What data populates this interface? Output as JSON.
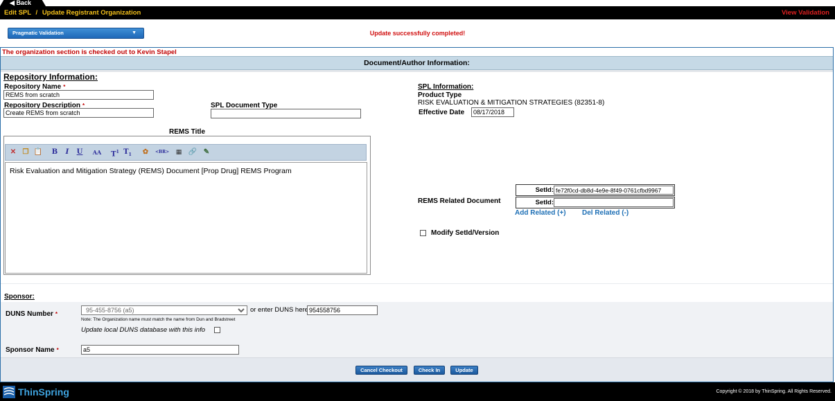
{
  "nav": {
    "back_label": "Back",
    "crumb_edit": "Edit SPL",
    "crumb_sep": "/",
    "crumb_current": "Update Registrant Organization",
    "view_validation": "View Validation"
  },
  "validation_dropdown": {
    "label": "Pragmatic Validation"
  },
  "status": {
    "success": "Update successfully completed!",
    "checkout": "The organization section is checked out to Kevin Stapel"
  },
  "section_title": "Document/Author Information:",
  "repository": {
    "heading": "Repository Information:",
    "name_label": "Repository Name",
    "name_value": "REMS from scratch",
    "desc_label": "Repository Description",
    "desc_value": "Create REMS from scratch",
    "required_mark": "*"
  },
  "spl_doc_type": {
    "label": "SPL Document Type",
    "value": ""
  },
  "spl_info": {
    "heading": "SPL Information:",
    "product_type_label": "Product Type",
    "product_type_value": "RISK EVALUATION & MITIGATION STRATEGIES (82351-8)",
    "effective_date_label": "Effective Date",
    "effective_date_value": "08/17/2018"
  },
  "rems_title": {
    "label": "REMS Title",
    "content": "Risk Evaluation and Mitigation Strategy (REMS) Document [Prop Drug] REMS Program"
  },
  "rems_related": {
    "label": "REMS Related Document",
    "setid_label": "SetId:",
    "setid_1": "fe72f0cd-db8d-4e9e-8f49-0761cfbd9967",
    "setid_2": "",
    "add_related": "Add Related (+)",
    "del_related": "Del Related (-)",
    "modify_label": "Modify SetId/Version"
  },
  "sponsor": {
    "heading": "Sponsor:",
    "duns_label": "DUNS Number",
    "duns_selected": "95-455-8756 (a5)",
    "duns_enter_label": "or enter DUNS here:",
    "duns_enter_value": "954558756",
    "duns_note": "Note: The Organization name must match the name from Dun and Bradstreet",
    "update_local_label": "Update local DUNS database with this info",
    "sponsor_name_label": "Sponsor Name",
    "sponsor_name_value": "a5",
    "required_mark": "*"
  },
  "actions": {
    "cancel_checkout": "Cancel Checkout",
    "check_in": "Check In",
    "update": "Update"
  },
  "footer": {
    "brand": "ThinSpring",
    "copyright": "Copyright © 2018 by ThinSpring. All Rights Reserved."
  },
  "colors": {
    "header_text": "#f5c21b",
    "alert_red": "#d01010",
    "section_bar": "#c6d9e6",
    "button_blue": "#1c5a9e",
    "brand_blue": "#3fa4e0"
  }
}
